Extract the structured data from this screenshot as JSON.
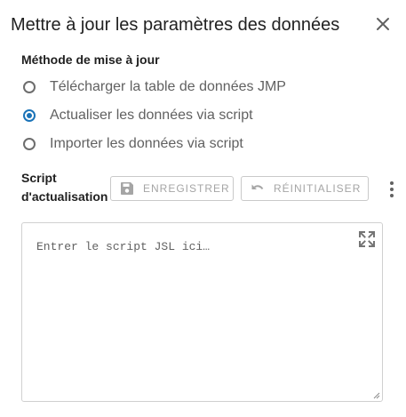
{
  "dialog": {
    "title": "Mettre à jour les paramètres des données",
    "close_icon": "close-icon"
  },
  "method": {
    "label": "Méthode de mise à jour",
    "options": [
      {
        "label": "Télécharger la table de données JMP",
        "selected": false
      },
      {
        "label": "Actualiser les données via script",
        "selected": true
      },
      {
        "label": "Importer les données via script",
        "selected": false
      }
    ]
  },
  "script": {
    "label": "Script d'actualisation",
    "save_button": {
      "label": "ENREGISTRER",
      "icon": "save-icon",
      "enabled": false
    },
    "reset_button": {
      "label": "RÉINITIALISER",
      "icon": "undo-icon",
      "enabled": false
    },
    "more_icon": "more-vert-icon",
    "editor": {
      "placeholder": "Entrer le script JSL ici…",
      "value": "",
      "expand_icon": "fullscreen-icon"
    }
  },
  "colors": {
    "accent": "#1a73b8",
    "text": "#212121",
    "secondary_text": "#616161",
    "disabled": "#a5a5a5",
    "border": "#c9c9c9"
  }
}
